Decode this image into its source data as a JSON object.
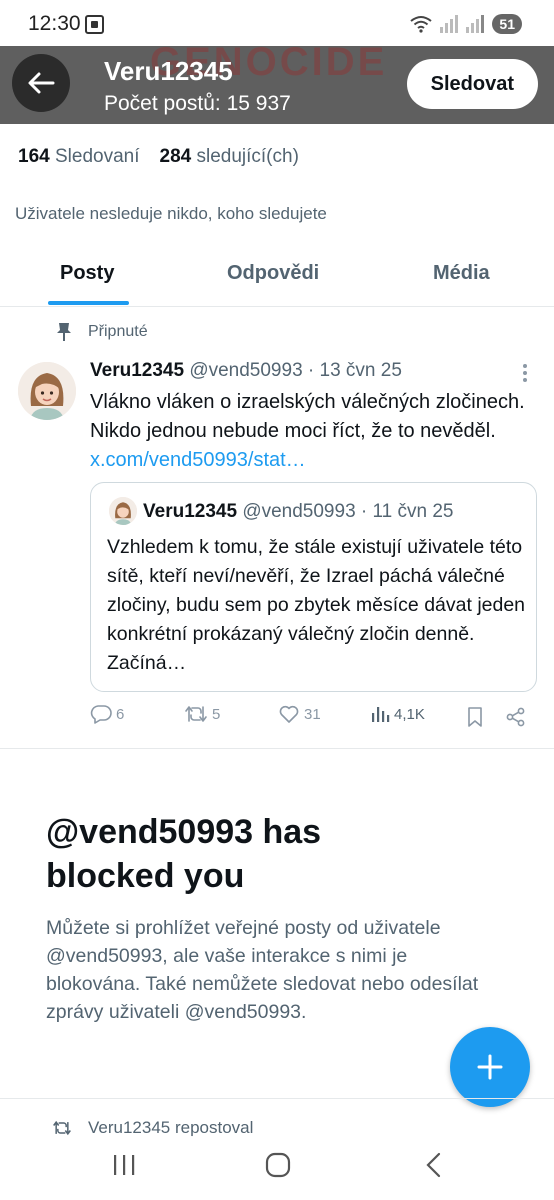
{
  "status_bar": {
    "time": "12:30",
    "battery": "51"
  },
  "header": {
    "display_name": "Veru12345",
    "post_count_label": "Počet postů: 15 937",
    "follow_button": "Sledovat",
    "banner_text": "GENOCIDE"
  },
  "stats": {
    "following_count": "164",
    "following_label": "Sledovaní",
    "followers_count": "284",
    "followers_label": "sledující(ch)"
  },
  "mutual_note": "Uživatele nesleduje nikdo, koho sledujete",
  "tabs": [
    {
      "label": "Posty"
    },
    {
      "label": "Odpovědi"
    },
    {
      "label": "Média"
    }
  ],
  "pinned_post": {
    "pinned_label": "Připnuté",
    "author_name": "Veru12345",
    "handle_date": "@vend50993 · 13 čvn 25",
    "text": "Vlákno vláken o izraelských válečných zločinech. Nikdo jednou nebude moci říct, že to nevěděl.",
    "link": "x.com/vend50993/stat…",
    "quote": {
      "author_name": "Veru12345",
      "handle_date": "@vend50993 · 11 čvn 25",
      "text": "Vzhledem k tomu, že stále existují uživatele této sítě, kteří neví/nevěří, že Izrael páchá válečné zločiny, budu sem po zbytek měsíce dávat jeden konkrétní prokázaný válečný zločin denně. Začíná…"
    },
    "actions": {
      "replies": "6",
      "reposts": "5",
      "likes": "31",
      "views": "4,1K"
    }
  },
  "blocked_notice": {
    "title": "@vend50993 has blocked you",
    "text": "Můžete si prohlížet veřejné posty od uživatele @vend50993, ale vaše interakce s nimi je blokována. Také nemůžete sledovat nebo odesílat zprávy uživateli @vend50993."
  },
  "repost_note": "Veru12345 repostoval",
  "colors": {
    "accent": "#1d9bf0",
    "secondary_text": "#536471",
    "header_bg": "#5f5f5f"
  }
}
